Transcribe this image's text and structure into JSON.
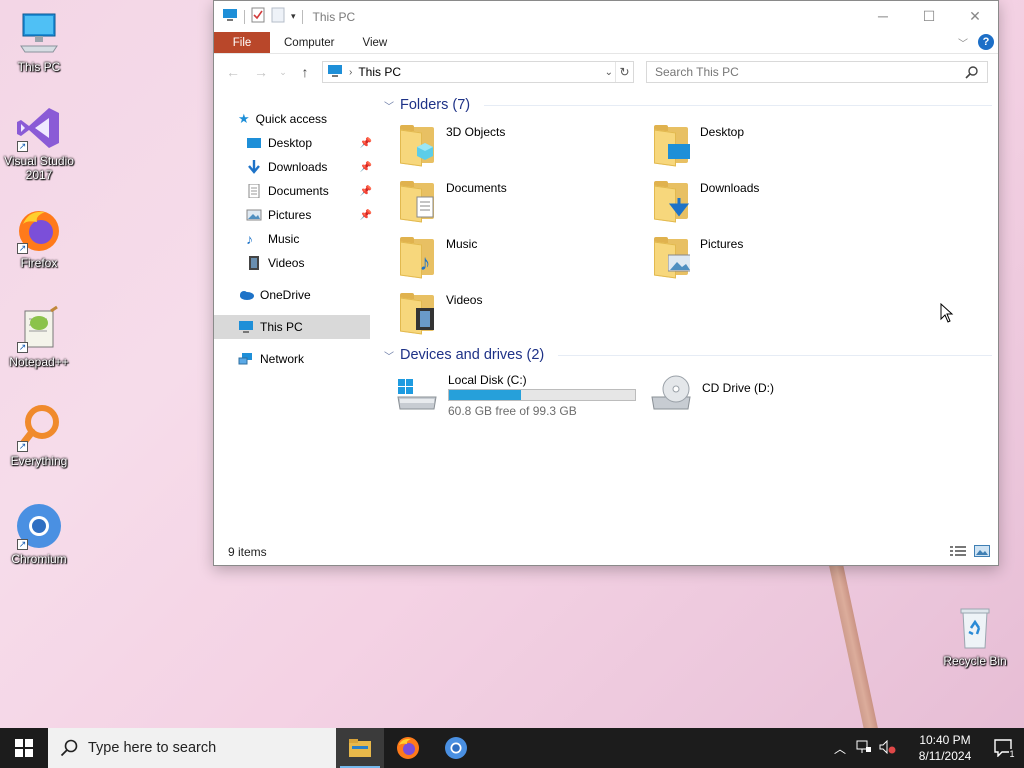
{
  "desktop": {
    "icons": [
      {
        "label": "This PC"
      },
      {
        "label": "Visual Studio 2017"
      },
      {
        "label": "Firefox"
      },
      {
        "label": "Notepad++"
      },
      {
        "label": "Everything"
      },
      {
        "label": "Chromium"
      },
      {
        "label": "Recycle Bin"
      }
    ]
  },
  "window": {
    "title": "This PC",
    "tabs": {
      "file": "File",
      "computer": "Computer",
      "view": "View"
    },
    "help": "?",
    "address": {
      "path": "This PC"
    },
    "search": {
      "placeholder": "Search This PC"
    },
    "nav": {
      "quick_access": "Quick access",
      "desktop": "Desktop",
      "downloads": "Downloads",
      "documents": "Documents",
      "pictures": "Pictures",
      "music": "Music",
      "videos": "Videos",
      "onedrive": "OneDrive",
      "this_pc": "This PC",
      "network": "Network"
    },
    "folders_header": "Folders (7)",
    "folders": [
      {
        "name": "3D Objects"
      },
      {
        "name": "Desktop"
      },
      {
        "name": "Documents"
      },
      {
        "name": "Downloads"
      },
      {
        "name": "Music"
      },
      {
        "name": "Pictures"
      },
      {
        "name": "Videos"
      }
    ],
    "drives_header": "Devices and drives (2)",
    "drives": [
      {
        "name": "Local Disk (C:)",
        "free_text": "60.8 GB free of 99.3 GB",
        "used_fraction": 0.388
      },
      {
        "name": "CD Drive (D:)"
      }
    ],
    "status": "9 items"
  },
  "taskbar": {
    "search_placeholder": "Type here to search",
    "time": "10:40 PM",
    "date": "8/11/2024",
    "notif_count": "1"
  }
}
